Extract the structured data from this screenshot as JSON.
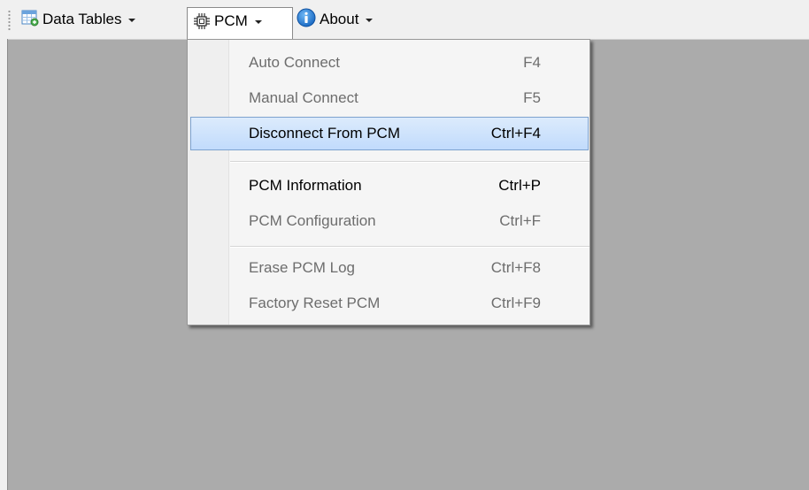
{
  "toolbar": {
    "data_tables": {
      "label": "Data Tables",
      "icon": "table-icon"
    },
    "pcm": {
      "label": "PCM",
      "icon": "chip-icon"
    },
    "about": {
      "label": "About",
      "icon": "info-icon"
    }
  },
  "pcm_menu": {
    "items": [
      {
        "label": "Auto Connect",
        "shortcut": "F4",
        "enabled": false
      },
      {
        "label": "Manual Connect",
        "shortcut": "F5",
        "enabled": false
      },
      {
        "label": "Disconnect From PCM",
        "shortcut": "Ctrl+F4",
        "enabled": true,
        "highlighted": true
      },
      {
        "label": "PCM Information",
        "shortcut": "Ctrl+P",
        "enabled": true
      },
      {
        "label": "PCM Configuration",
        "shortcut": "Ctrl+F",
        "enabled": false
      },
      {
        "label": "Erase PCM Log",
        "shortcut": "Ctrl+F8",
        "enabled": false
      },
      {
        "label": "Factory Reset PCM",
        "shortcut": "Ctrl+F9",
        "enabled": false
      }
    ]
  },
  "colors": {
    "workspace": "#ababab",
    "toolbar": "#f0f0f0",
    "highlight_border": "#7da2ce",
    "info_blue": "#1e7fd6"
  }
}
